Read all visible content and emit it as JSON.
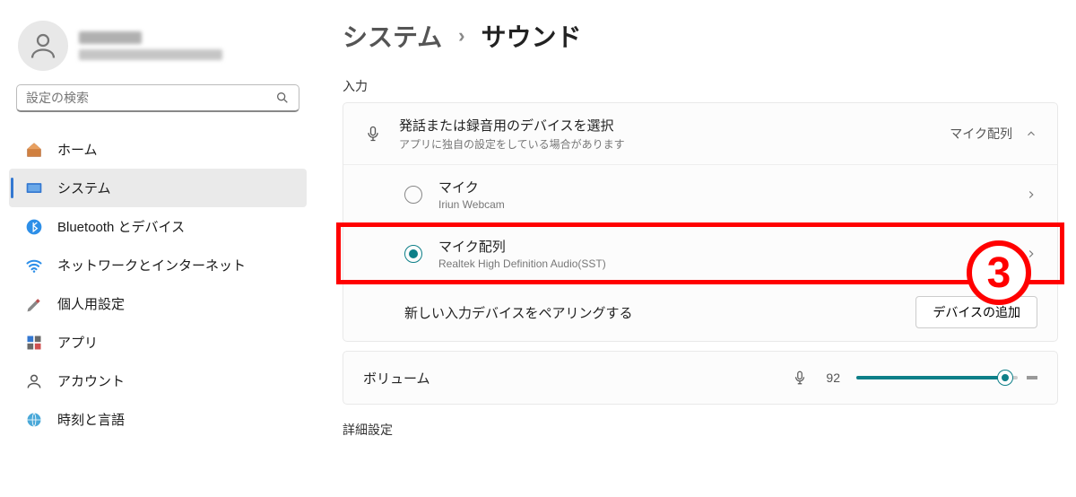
{
  "user": {
    "name_redacted": true,
    "email_redacted": true
  },
  "search": {
    "placeholder": "設定の検索"
  },
  "sidebar": {
    "items": [
      {
        "label": "ホーム"
      },
      {
        "label": "システム"
      },
      {
        "label": "Bluetooth とデバイス"
      },
      {
        "label": "ネットワークとインターネット"
      },
      {
        "label": "個人用設定"
      },
      {
        "label": "アプリ"
      },
      {
        "label": "アカウント"
      },
      {
        "label": "時刻と言語"
      }
    ],
    "selected_index": 1
  },
  "breadcrumb": {
    "root": "システム",
    "sep": "›",
    "current": "サウンド"
  },
  "input_section": {
    "label": "入力",
    "header": {
      "title": "発話または録音用のデバイスを選択",
      "subtitle": "アプリに独自の設定をしている場合があります",
      "selected_label": "マイク配列"
    },
    "devices": [
      {
        "title": "マイク",
        "subtitle": "Iriun Webcam",
        "checked": false
      },
      {
        "title": "マイク配列",
        "subtitle": "Realtek High Definition Audio(SST)",
        "checked": true
      }
    ],
    "pairing": {
      "label": "新しい入力デバイスをペアリングする",
      "button": "デバイスの追加"
    }
  },
  "volume": {
    "label": "ボリューム",
    "value": 92
  },
  "advanced_label": "詳細設定",
  "callout": {
    "number": "3"
  }
}
